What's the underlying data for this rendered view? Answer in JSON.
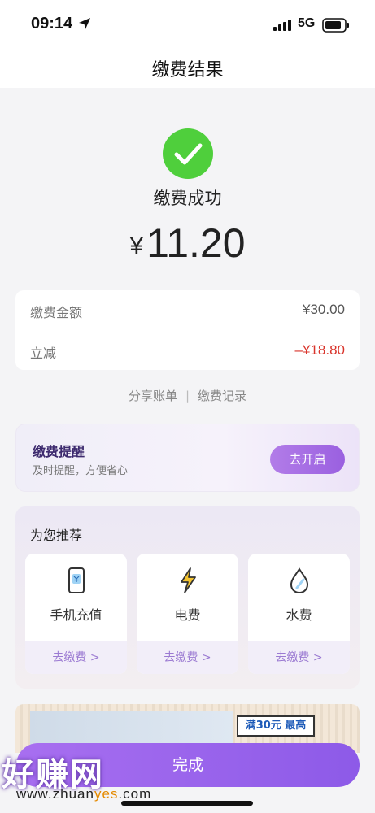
{
  "status_bar": {
    "time": "09:14",
    "network": "5G"
  },
  "header": {
    "title": "缴费结果"
  },
  "result": {
    "status": "缴费成功",
    "currency": "¥",
    "amount": "11.20"
  },
  "details": [
    {
      "label": "缴费金额",
      "value": "¥30.00"
    },
    {
      "label": "立减",
      "value": "–¥18.80"
    }
  ],
  "links": {
    "share": "分享账单",
    "records": "缴费记录"
  },
  "reminder": {
    "title": "缴费提醒",
    "subtitle": "及时提醒，方便省心",
    "button": "去开启"
  },
  "recommend": {
    "title": "为您推荐",
    "items": [
      {
        "icon": "phone-icon",
        "label": "手机充值",
        "action": "去缴费 >"
      },
      {
        "icon": "lightning-icon",
        "label": "电费",
        "action": "去缴费 >"
      },
      {
        "icon": "water-drop-icon",
        "label": "水费",
        "action": "去缴费 >"
      }
    ]
  },
  "banner": {
    "tag": "满30元 最高"
  },
  "footer": {
    "done_button": "完成"
  },
  "watermark": {
    "logo": "好赚网",
    "url_prefix": "www.zhuan",
    "url_highlight": "yes",
    "url_suffix": ".com"
  },
  "colors": {
    "accent": "#9b6ae8",
    "success": "#4fcf3c",
    "discount": "#d9342b"
  }
}
